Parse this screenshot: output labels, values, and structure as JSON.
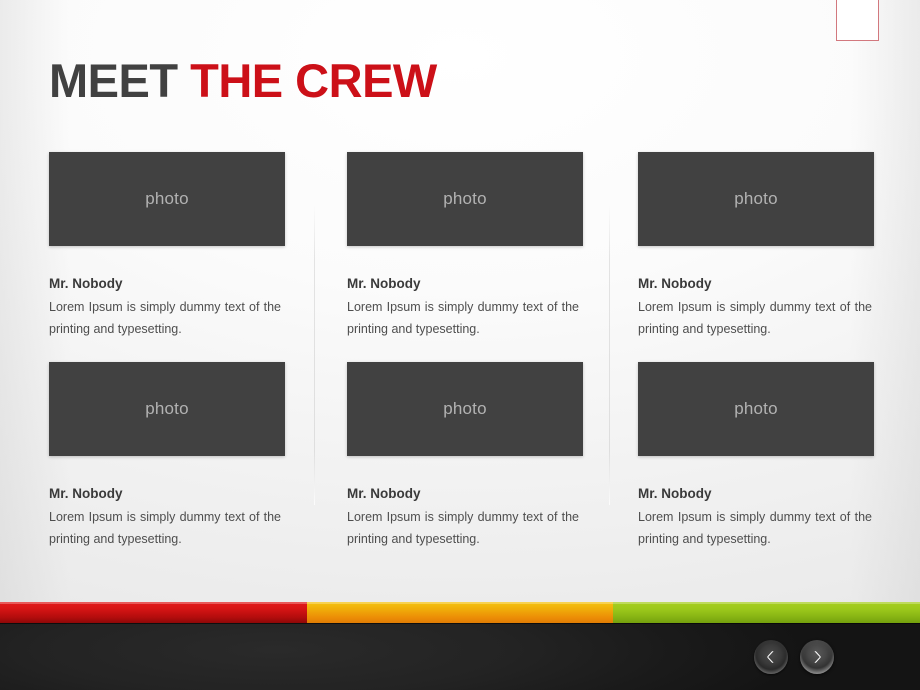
{
  "slide": {
    "title_primary": "MEET ",
    "title_accent": "THE CREW",
    "photo_placeholder_label": "photo",
    "accent_color": "#cc1018",
    "title_dark_color": "#414141",
    "photo_box_color": "#414141",
    "footer_color": "#1b1b1b"
  },
  "corner_mark": {
    "name": "corner-tag",
    "border_color": "#d2787e",
    "fill_color": "#ffffff"
  },
  "team": [
    {
      "photo_label": "photo",
      "name": "Mr. Nobody",
      "description": "Lorem Ipsum is simply dummy text of the printing and typesetting."
    },
    {
      "photo_label": "photo",
      "name": "Mr. Nobody",
      "description": "Lorem Ipsum is simply dummy text of the printing and typesetting."
    },
    {
      "photo_label": "photo",
      "name": "Mr. Nobody",
      "description": "Lorem Ipsum is simply dummy text of the printing and typesetting."
    },
    {
      "photo_label": "photo",
      "name": "Mr. Nobody",
      "description": "Lorem Ipsum is simply dummy text of the printing and typesetting."
    },
    {
      "photo_label": "photo",
      "name": "Mr. Nobody",
      "description": "Lorem Ipsum is simply dummy text of the printing and typesetting."
    },
    {
      "photo_label": "photo",
      "name": "Mr. Nobody",
      "description": "Lorem Ipsum is simply dummy text of the printing and typesetting."
    }
  ],
  "color_bar": {
    "segments": [
      {
        "name": "red-segment",
        "color": "#d81515"
      },
      {
        "name": "orange-segment",
        "color": "#f0ad0a"
      },
      {
        "name": "green-segment",
        "color": "#9cc81b"
      }
    ]
  },
  "footer": {
    "nav": {
      "prev_label": "Previous slide",
      "prev_icon": "chevron-left-icon",
      "next_label": "Next slide",
      "next_icon": "chevron-right-icon"
    }
  }
}
